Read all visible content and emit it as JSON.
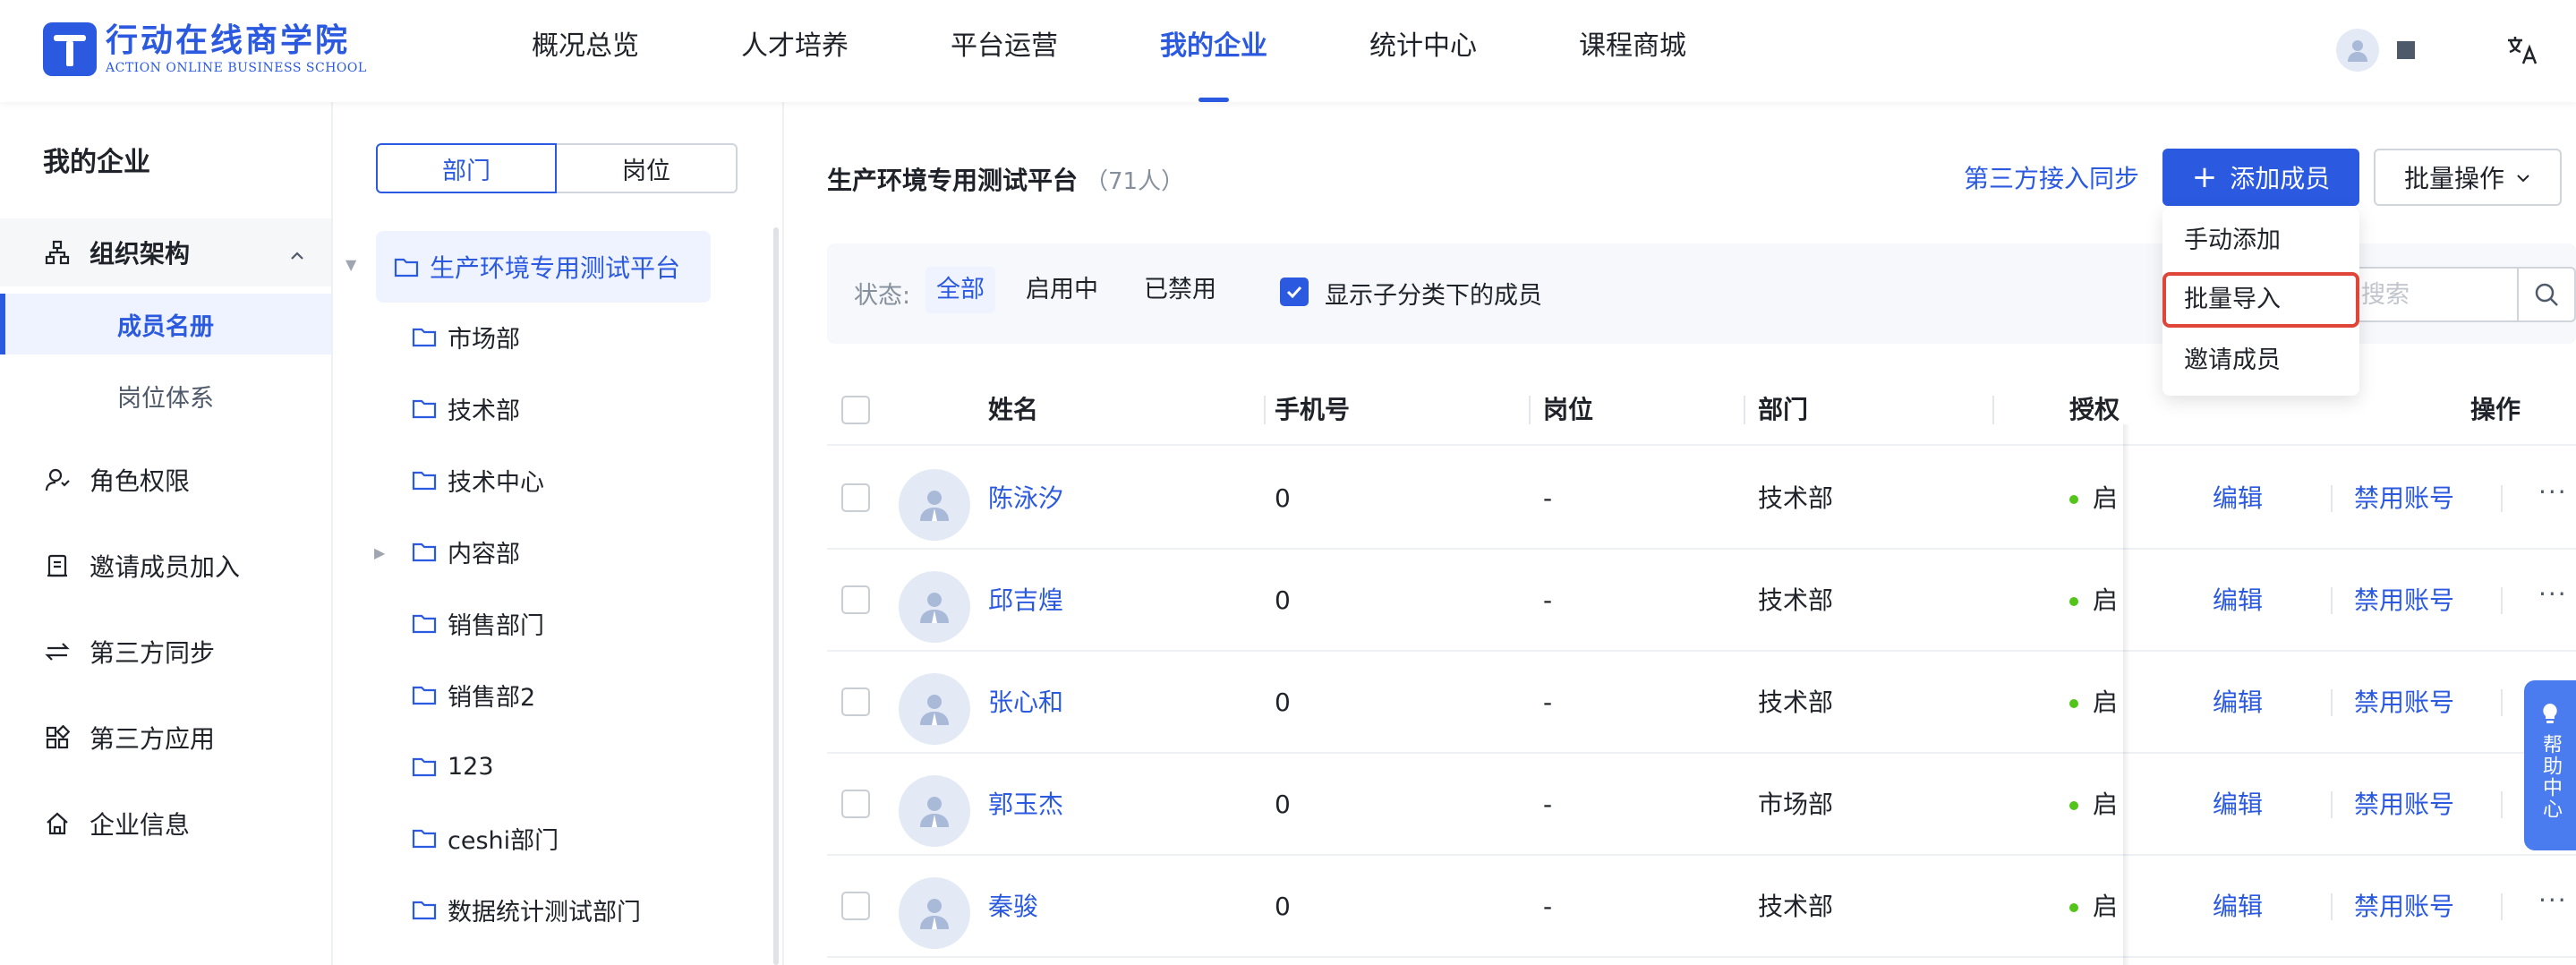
{
  "brand": {
    "name_cn": "行动在线商学院",
    "name_en": "ACTION ONLINE BUSINESS SCHOOL",
    "accent_color": "#2b5ae0"
  },
  "topnav": {
    "items": [
      "概况总览",
      "人才培养",
      "平台运营",
      "我的企业",
      "统计中心",
      "课程商城"
    ],
    "active": "我的企业"
  },
  "header_icons": [
    "avatar-icon",
    "square-icon",
    "translate-icon"
  ],
  "sidebar": {
    "title": "我的企业",
    "group": {
      "label": "组织架构",
      "icon": "org-chart-icon",
      "expanded": true
    },
    "sub_items": [
      {
        "label": "成员名册",
        "active": true
      },
      {
        "label": "岗位体系",
        "active": false
      }
    ],
    "items": [
      {
        "label": "角色权限",
        "icon": "user-role-icon"
      },
      {
        "label": "邀请成员加入",
        "icon": "invite-doc-icon"
      },
      {
        "label": "第三方同步",
        "icon": "sync-arrows-icon"
      },
      {
        "label": "第三方应用",
        "icon": "apps-grid-icon"
      },
      {
        "label": "企业信息",
        "icon": "home-icon"
      }
    ]
  },
  "tree": {
    "tabs": [
      "部门",
      "岗位"
    ],
    "active_tab": "部门",
    "root": "生产环境专用测试平台",
    "nodes": [
      {
        "label": "市场部",
        "has_children": false
      },
      {
        "label": "技术部",
        "has_children": false
      },
      {
        "label": "技术中心",
        "has_children": false
      },
      {
        "label": "内容部",
        "has_children": true
      },
      {
        "label": "销售部门",
        "has_children": false
      },
      {
        "label": "销售部2",
        "has_children": false
      },
      {
        "label": "123",
        "has_children": false
      },
      {
        "label": "ceshi部门",
        "has_children": false
      },
      {
        "label": "数据统计测试部门",
        "has_children": false
      }
    ]
  },
  "main": {
    "company": "生产环境专用测试平台",
    "count": "（71人）",
    "sync_link": "第三方接入同步",
    "add_button": "添加成员",
    "batch_button": "批量操作",
    "dropdown": {
      "items": [
        "手动添加",
        "批量导入",
        "邀请成员"
      ],
      "highlighted": "批量导入"
    },
    "filter": {
      "label": "状态:",
      "options": [
        "全部",
        "启用中",
        "已禁用"
      ],
      "active": "全部",
      "show_sub_label": "显示子分类下的成员",
      "show_sub_checked": true,
      "search_placeholder": "搜索"
    },
    "table": {
      "columns": [
        "姓名",
        "手机号",
        "岗位",
        "部门",
        "授权",
        "操作"
      ],
      "rows": [
        {
          "name": "陈泳汐",
          "phone": "0",
          "post": "-",
          "dept": "技术部",
          "status": "启",
          "edit": "编辑",
          "disable": "禁用账号",
          "more": "···"
        },
        {
          "name": "邱吉煌",
          "phone": "0",
          "post": "-",
          "dept": "技术部",
          "status": "启",
          "edit": "编辑",
          "disable": "禁用账号",
          "more": "···"
        },
        {
          "name": "张心和",
          "phone": "0",
          "post": "-",
          "dept": "技术部",
          "status": "启",
          "edit": "编辑",
          "disable": "禁用账号",
          "more": "···"
        },
        {
          "name": "郭玉杰",
          "phone": "0",
          "post": "-",
          "dept": "市场部",
          "status": "启",
          "edit": "编辑",
          "disable": "禁用账号",
          "more": "···"
        },
        {
          "name": "秦骏",
          "phone": "0",
          "post": "-",
          "dept": "技术部",
          "status": "启",
          "edit": "编辑",
          "disable": "禁用账号",
          "more": "···"
        }
      ]
    }
  },
  "help": {
    "label": "帮助中心",
    "icon": "lightbulb-icon",
    "color": "#4a7cf0"
  },
  "status_color": "#52c41a",
  "highlight_color": "#e0453a"
}
